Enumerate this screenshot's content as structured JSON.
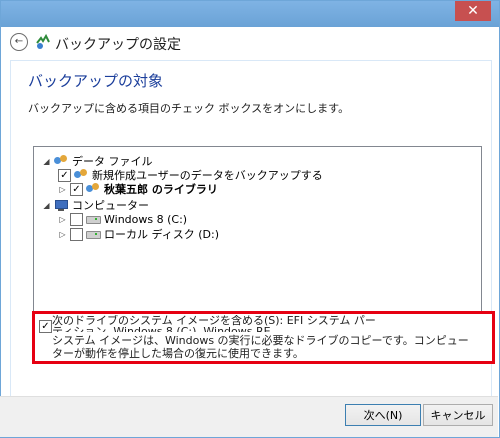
{
  "window": {
    "title": "バックアップの設定",
    "close_glyph": "✕"
  },
  "page": {
    "title": "バックアップの対象",
    "description": "バックアップに含める項目のチェック ボックスをオンにします。"
  },
  "tree": {
    "data_files": "データ ファイル",
    "new_users": "新規作成ユーザーのデータをバックアップする",
    "library": "秋葉五郎 のライブラリ",
    "computer": "コンピューター",
    "drive_c": "Windows 8 (C:)",
    "drive_d": "ローカル ディスク (D:)"
  },
  "system_image": {
    "label": "次のドライブのシステム イメージを含める(S): EFI システム パーティション, Windows 8 (C:), Windows RE",
    "description": "システム イメージは、Windows の実行に必要なドライブのコピーです。コンピューターが動作を停止した場合の復元に使用できます。"
  },
  "buttons": {
    "next": "次へ(N)",
    "cancel": "キャンセル"
  },
  "icons": {
    "back": "back-arrow-icon",
    "app": "backup-icon",
    "users": "users-icon",
    "computer": "computer-icon",
    "disk": "disk-icon"
  },
  "colors": {
    "title": "#1b3e9b",
    "highlight": "#e60012",
    "titlebar": "#7fb3e4",
    "close": "#c75050"
  }
}
